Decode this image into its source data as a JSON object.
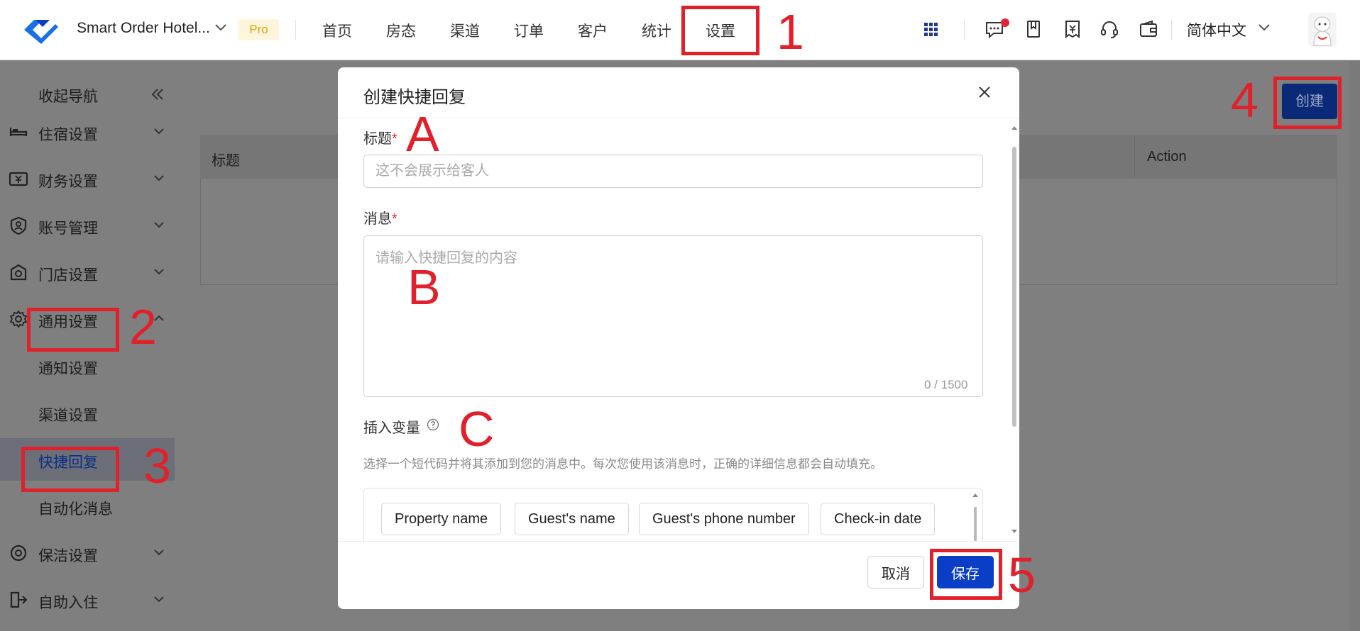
{
  "topbar": {
    "hotel_name": "Smart Order Hotel...",
    "badge": "Pro",
    "nav": [
      "首页",
      "房态",
      "渠道",
      "订单",
      "客户",
      "统计",
      "设置"
    ],
    "language": "简体中文",
    "icons": [
      "grid-icon",
      "message-icon",
      "book-icon",
      "invoice-icon",
      "headset-icon",
      "wallet-icon"
    ]
  },
  "sidebar": {
    "collapse": "收起导航",
    "items": [
      {
        "label": "住宿设置",
        "icon": "bed-icon"
      },
      {
        "label": "财务设置",
        "icon": "finance-icon"
      },
      {
        "label": "账号管理",
        "icon": "account-icon"
      },
      {
        "label": "门店设置",
        "icon": "store-icon"
      },
      {
        "label": "通用设置",
        "icon": "gear-icon"
      },
      {
        "label": "通知设置"
      },
      {
        "label": "渠道设置"
      },
      {
        "label": "快捷回复"
      },
      {
        "label": "自动化消息"
      },
      {
        "label": "保洁设置",
        "icon": "cleaning-icon"
      },
      {
        "label": "自助入住",
        "icon": "checkin-icon"
      }
    ]
  },
  "main": {
    "create_button": "创建",
    "table_headers": [
      "标题",
      "Action"
    ]
  },
  "modal": {
    "title": "创建快捷回复",
    "title_label": "标题",
    "title_placeholder": "这不会展示给客人",
    "message_label": "消息",
    "message_placeholder": "请输入快捷回复的内容",
    "counter": "0 / 1500",
    "variables_label": "插入变量",
    "variables_help": "选择一个短代码并将其添加到您的消息中。每次您使用该消息时，正确的详细信息都会自动填充。",
    "chips": [
      "Property name",
      "Guest's name",
      "Guest's phone number",
      "Check-in date"
    ],
    "cancel": "取消",
    "save": "保存"
  },
  "annotations": {
    "n1": "1",
    "n2": "2",
    "n3": "3",
    "n4": "4",
    "n5": "5",
    "a": "A",
    "b": "B",
    "c": "C"
  },
  "colors": {
    "primary": "#0a3ec7",
    "annotation": "#e0202a",
    "pro_badge_text": "#e5a100"
  }
}
